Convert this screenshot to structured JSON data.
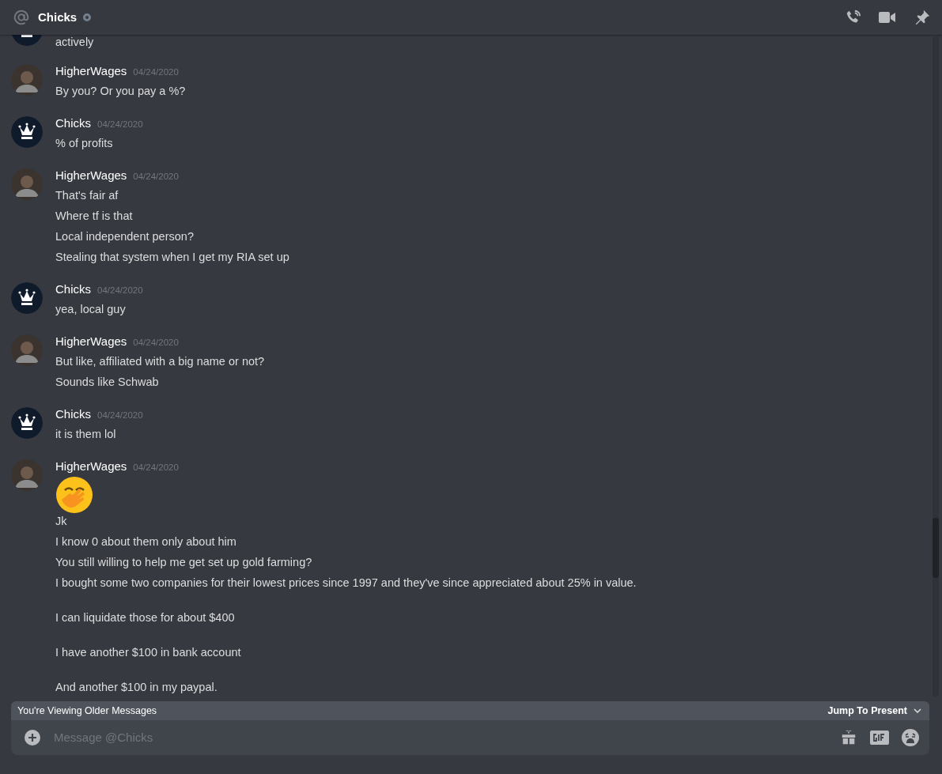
{
  "header": {
    "channel": "Chicks",
    "online": false
  },
  "messages": [
    {
      "kind": "crown",
      "partial": true,
      "lines": [
        {
          "kind": "text",
          "text": "actively"
        }
      ]
    },
    {
      "author": "HigherWages",
      "kind": "photo",
      "partial": false,
      "timestamp": "04/24/2020",
      "lines": [
        {
          "kind": "text",
          "text": "By you? Or you pay a %?"
        }
      ]
    },
    {
      "author": "Chicks",
      "kind": "crown",
      "partial": false,
      "timestamp": "04/24/2020",
      "lines": [
        {
          "kind": "text",
          "text": "% of profits"
        }
      ]
    },
    {
      "author": "HigherWages",
      "kind": "photo",
      "partial": false,
      "timestamp": "04/24/2020",
      "lines": [
        {
          "kind": "text",
          "text": "That's fair af"
        },
        {
          "kind": "text",
          "text": "Where tf is that"
        },
        {
          "kind": "text",
          "text": "Local independent person?"
        },
        {
          "kind": "text",
          "text": "Stealing that system when I get my RIA set up"
        }
      ]
    },
    {
      "author": "Chicks",
      "kind": "crown",
      "partial": false,
      "timestamp": "04/24/2020",
      "lines": [
        {
          "kind": "text",
          "text": "yea, local guy"
        }
      ]
    },
    {
      "author": "HigherWages",
      "kind": "photo",
      "partial": false,
      "timestamp": "04/24/2020",
      "lines": [
        {
          "kind": "text",
          "text": "But like, affiliated with a big name or not?"
        },
        {
          "kind": "text",
          "text": "Sounds like Schwab"
        }
      ]
    },
    {
      "author": "Chicks",
      "kind": "crown",
      "partial": false,
      "timestamp": "04/24/2020",
      "lines": [
        {
          "kind": "text",
          "text": "it is them lol"
        }
      ]
    },
    {
      "author": "HigherWages",
      "kind": "photo",
      "partial": false,
      "timestamp": "04/24/2020",
      "lines": [
        {
          "kind": "emoji"
        },
        {
          "kind": "text",
          "text": "Jk"
        },
        {
          "kind": "text",
          "text": "I know 0 about them only about him"
        },
        {
          "kind": "text",
          "text": "You still willing to help me get set up gold farming?"
        },
        {
          "kind": "text",
          "text": "I bought some two companies for their lowest prices since 1997 and they've since appreciated about 25% in value.\n\nI can liquidate those for about $400\n\nI have another $100 in bank account\n\nAnd another $100 in my paypal."
        }
      ]
    }
  ],
  "older_bar": {
    "label": "You're Viewing Older Messages",
    "action": "Jump To Present"
  },
  "composer": {
    "placeholder": "Message @Chicks"
  }
}
